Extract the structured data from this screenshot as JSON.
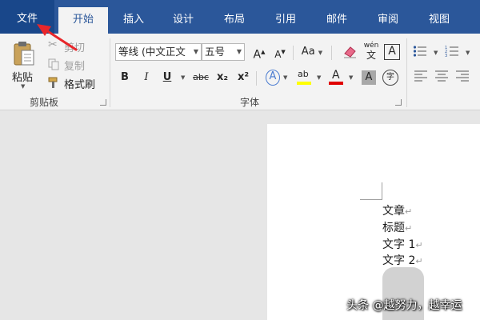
{
  "tabs": [
    {
      "label": "文件"
    },
    {
      "label": "开始"
    },
    {
      "label": "插入"
    },
    {
      "label": "设计"
    },
    {
      "label": "布局"
    },
    {
      "label": "引用"
    },
    {
      "label": "邮件"
    },
    {
      "label": "审阅"
    },
    {
      "label": "视图"
    }
  ],
  "clipboard": {
    "paste_label": "粘贴",
    "cut_label": "剪切",
    "copy_label": "复制",
    "format_painter_label": "格式刷",
    "group_label": "剪贴板"
  },
  "font": {
    "font_name": "等线 (中文正文",
    "font_size": "五号",
    "grow_label": "A",
    "shrink_label": "A",
    "case_label": "Aa",
    "pinyin_top": "wén",
    "pinyin_bottom": "文",
    "border_label": "A",
    "bold_label": "B",
    "italic_label": "I",
    "underline_label": "U",
    "strike_label": "abc",
    "subscript_label": "x₂",
    "superscript_label": "x²",
    "effects_label": "A",
    "highlight_label": "ab",
    "font_color_label": "A",
    "shading_label": "A",
    "enclose_label": "字",
    "group_label": "字体",
    "highlight_color": "#ffff00",
    "font_color": "#e00000"
  },
  "document": {
    "lines": [
      "文章",
      "标题",
      "文字 1",
      "文字 2"
    ],
    "paragraph_mark": "↵"
  },
  "watermark": "头条 @越努力，越幸运",
  "colors": {
    "tabbar": "#2b579a",
    "ribbon": "#f3f3f3",
    "arrow": "#e8262a"
  }
}
